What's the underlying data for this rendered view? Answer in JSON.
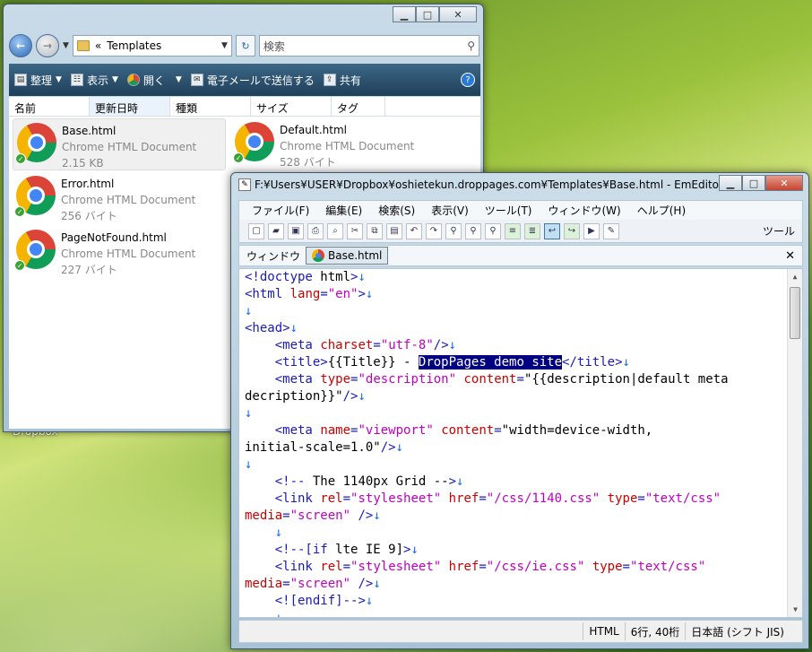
{
  "desktop": {
    "label": "Dropbox"
  },
  "explorer": {
    "address": "Templates",
    "address_prefix": "«",
    "search_placeholder": "検索",
    "commands": [
      "整理",
      "表示",
      "開く",
      "電子メールで送信する",
      "共有"
    ],
    "columns": [
      "名前",
      "更新日時",
      "種類",
      "サイズ",
      "タグ"
    ],
    "files": [
      {
        "name": "Base.html",
        "type": "Chrome HTML Document",
        "size": "2.15 KB"
      },
      {
        "name": "Default.html",
        "type": "Chrome HTML Document",
        "size": "528 バイト"
      },
      {
        "name": "Error.html",
        "type": "Chrome HTML Document",
        "size": "256 バイト"
      },
      {
        "name": "PageNotFound.html",
        "type": "Chrome HTML Document",
        "size": "227 バイト"
      }
    ]
  },
  "emeditor": {
    "title": "F:¥Users¥USER¥Dropbox¥oshietekun.droppages.com¥Templates¥Base.html - EmEditor",
    "menu": [
      "ファイル(F)",
      "編集(E)",
      "検索(S)",
      "表示(V)",
      "ツール(T)",
      "ウィンドウ(W)",
      "ヘルプ(H)"
    ],
    "tools_label": "ツール",
    "window_label": "ウィンドウ",
    "tab_label": "Base.html",
    "status": {
      "mode": "HTML",
      "position": "6行, 40桁",
      "encoding": "日本語 (シフト JIS)"
    }
  },
  "code_lines": [
    "<!doctype html>↓",
    "<html lang=\"en\">↓",
    "↓",
    "<head>↓",
    "    <meta charset=\"utf-8\"/>↓",
    "    <title>{{Title}} - DropPages demo site</title>↓",
    "    <meta type=\"description\" content=\"{{description|default meta",
    "decription}}\"/>↓",
    "↓",
    "    <meta name=\"viewport\" content=\"width=device-width,",
    "initial-scale=1.0\"/>↓",
    "↓",
    "    <!-- The 1140px Grid -->↓",
    "    <link rel=\"stylesheet\" href=\"/css/1140.css\" type=\"text/css\"",
    "media=\"screen\" />↓",
    "    ↓",
    "    <!--[if lte IE 9]>↓",
    "    <link rel=\"stylesheet\" href=\"/css/ie.css\" type=\"text/css\"",
    "media=\"screen\" />↓",
    "    <![endif]-->↓",
    "    ↓"
  ],
  "selection": "DropPages demo site"
}
